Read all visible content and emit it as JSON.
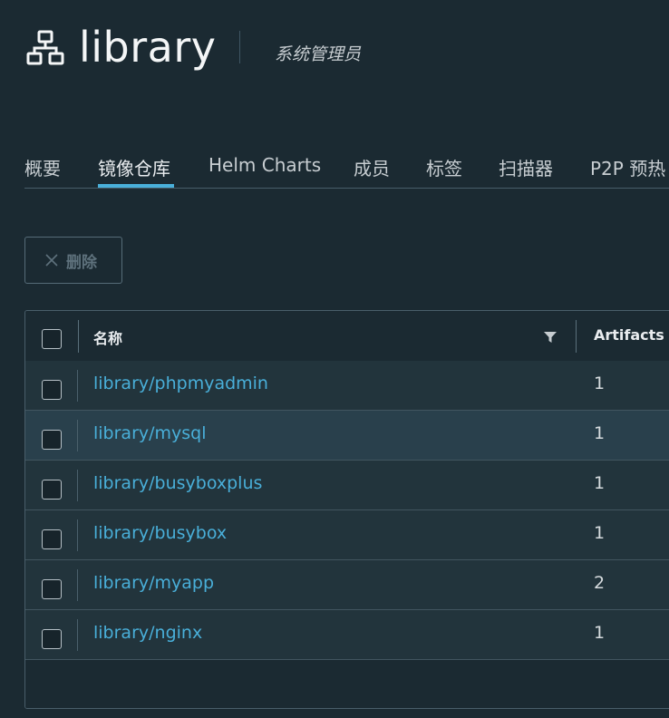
{
  "header": {
    "project_name": "library",
    "role": "系统管理员",
    "project_icon": "project-network-icon"
  },
  "tabs": [
    {
      "label": "概要",
      "active": false
    },
    {
      "label": "镜像仓库",
      "active": true
    },
    {
      "label": "Helm Charts",
      "active": false
    },
    {
      "label": "成员",
      "active": false
    },
    {
      "label": "标签",
      "active": false
    },
    {
      "label": "扫描器",
      "active": false
    },
    {
      "label": "P2P 预热",
      "active": false
    }
  ],
  "toolbar": {
    "delete_label": "删除",
    "delete_icon": "close-icon"
  },
  "table": {
    "columns": {
      "name": "名称",
      "artifacts": "Artifacts"
    },
    "rows": [
      {
        "name": "library/phpmyadmin",
        "artifacts": "1"
      },
      {
        "name": "library/mysql",
        "artifacts": "1"
      },
      {
        "name": "library/busyboxplus",
        "artifacts": "1"
      },
      {
        "name": "library/busybox",
        "artifacts": "1"
      },
      {
        "name": "library/myapp",
        "artifacts": "2"
      },
      {
        "name": "library/nginx",
        "artifacts": "1"
      }
    ]
  },
  "colors": {
    "background": "#1b2a32",
    "row_background": "#22343c",
    "row_hover": "#29404c",
    "link": "#49afd9",
    "accent": "#49afd9"
  }
}
